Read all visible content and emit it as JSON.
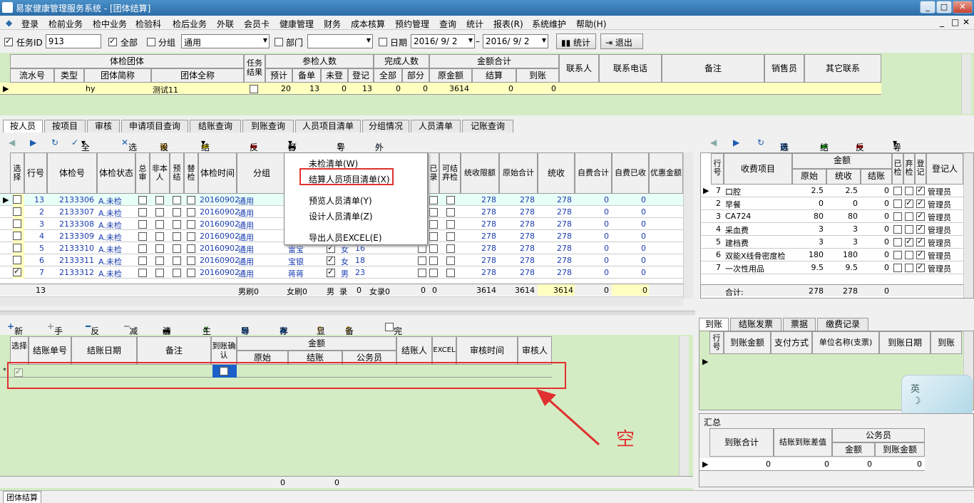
{
  "window": {
    "title": "易家健康管理服务系统 - [团体结算]",
    "min": "_",
    "restore": "□",
    "close": "✕"
  },
  "menu": [
    "登录",
    "检前业务",
    "检中业务",
    "检验科",
    "检后业务",
    "外联",
    "会员卡",
    "健康管理",
    "财务",
    "成本核算",
    "预约管理",
    "查询",
    "统计",
    "报表(R)",
    "系统维护",
    "帮助(H)"
  ],
  "filter": {
    "task_id_label": "任务ID",
    "task_id": "913",
    "all_label": "全部",
    "group_label": "分组",
    "group_value": "通用",
    "dept_label": "部门",
    "dept_value": "",
    "date_label": "日期",
    "date_from": "2016/ 9/ 2",
    "date_sep": "–",
    "date_to": "2016/ 9/ 2",
    "stats": "统计",
    "exit": "退出"
  },
  "top_grid": {
    "group_title": "体检团体",
    "cols1": [
      "流水号",
      "类型",
      "团体简称",
      "团体全称"
    ],
    "task_result": "任务结果",
    "participants": "参检人数",
    "part_cols": [
      "预计",
      "备单",
      "未登",
      "登记"
    ],
    "done": "完成人数",
    "done_cols": [
      "全部",
      "部分"
    ],
    "amount": "金额合计",
    "amount_cols": [
      "原金额",
      "结算",
      "到账"
    ],
    "contact": "联系人",
    "phone": "联系电话",
    "note": "备注",
    "sales": "销售员",
    "other": "其它联系",
    "row": {
      "serial": "",
      "type": "",
      "short": "hy",
      "full": "测试11",
      "expected": "20",
      "prep": "13",
      "unreg": "0",
      "reg": "13",
      "all": "0",
      "part": "0",
      "orig": "3614",
      "settle": "0",
      "arrived": "0"
    }
  },
  "tabs": [
    "按人员",
    "按项目",
    "审核",
    "申请项目查询",
    "结账查询",
    "到账查询",
    "人员项目清单",
    "分组情况",
    "人员清单",
    "记账查询"
  ],
  "mid_toolbar": [
    "全选",
    "选空",
    "设置",
    "结账",
    "反结",
    "打印",
    "导出",
    "外联"
  ],
  "mid_headers": [
    "选择",
    "行号",
    "体检号",
    "体检状态",
    "总审",
    "非本人",
    "预结",
    "替检",
    "体检时间",
    "分组",
    "已录",
    "可结弃检",
    "统收限额",
    "原始合计",
    "统收",
    "自费合计",
    "自费已收",
    "优惠金额"
  ],
  "persons": [
    {
      "no": "13",
      "id": "2133306",
      "status": "A.未检",
      "time": "20160902",
      "group": "通用",
      "name": "",
      "sex": "",
      "age": "",
      "limit": "278",
      "orig": "278",
      "coll": "278",
      "self": "0",
      "paid": "0",
      "sel": false
    },
    {
      "no": "2",
      "id": "2133307",
      "status": "A.未检",
      "time": "20160902",
      "group": "通用",
      "name": "",
      "sex": "",
      "age": "",
      "limit": "278",
      "orig": "278",
      "coll": "278",
      "self": "0",
      "paid": "0",
      "sel": false
    },
    {
      "no": "3",
      "id": "2133308",
      "status": "A.未检",
      "time": "20160902",
      "group": "通用",
      "name": "",
      "sex": "",
      "age": "",
      "limit": "278",
      "orig": "278",
      "coll": "278",
      "self": "0",
      "paid": "0",
      "sel": false
    },
    {
      "no": "4",
      "id": "2133309",
      "status": "A.未检",
      "time": "20160902",
      "group": "通用",
      "name": "",
      "sex": "",
      "age": "",
      "limit": "278",
      "orig": "278",
      "coll": "278",
      "self": "0",
      "paid": "0",
      "sel": false
    },
    {
      "no": "5",
      "id": "2133310",
      "status": "A.未检",
      "time": "20160902",
      "group": "通用",
      "name": "雷宝",
      "sex": "女",
      "age": "16",
      "limit": "278",
      "orig": "278",
      "coll": "278",
      "self": "0",
      "paid": "0",
      "sel": false
    },
    {
      "no": "6",
      "id": "2133311",
      "status": "A.未检",
      "time": "20160902",
      "group": "通用",
      "name": "宝银",
      "sex": "女",
      "age": "18",
      "limit": "278",
      "orig": "278",
      "coll": "278",
      "self": "0",
      "paid": "0",
      "sel": false
    },
    {
      "no": "7",
      "id": "2133312",
      "status": "A.未检",
      "time": "20160902",
      "group": "通用",
      "name": "蒋蒋",
      "sex": "男",
      "age": "23",
      "limit": "278",
      "orig": "278",
      "coll": "278",
      "self": "0",
      "paid": "0",
      "sel": true
    }
  ],
  "mid_footer": {
    "count": "13",
    "male": "男刷0",
    "female": "女刷0",
    "m": "男",
    "rec": "录",
    "zero": "0",
    "frec": "女录0",
    "a": "0",
    "b": "0",
    "limit": "3614",
    "orig": "3614",
    "coll": "3614",
    "self": "0",
    "paid": "0"
  },
  "popup": [
    "未检清单(W)",
    "结算人员项目清单(X)",
    "预览人员清单(Y)",
    "设计人员清单(Z)",
    "导出人员EXCEL(E)"
  ],
  "right_toolbar": [
    "选择",
    "结账",
    "反结",
    "导出"
  ],
  "fee_headers": {
    "row": "行号",
    "item": "收费项目",
    "amount": "金额",
    "orig": "原始",
    "coll": "统收",
    "settle": "结账",
    "checked": "已检",
    "waived": "弃检",
    "reg": "登记",
    "reg_by": "登记人"
  },
  "fees": [
    {
      "no": "7",
      "item": "口腔",
      "orig": "2.5",
      "coll": "2.5",
      "settle": "0",
      "c1": false,
      "c2": false,
      "c3": true,
      "by": "管理员"
    },
    {
      "no": "2",
      "item": "早餐",
      "orig": "0",
      "coll": "0",
      "settle": "0",
      "c1": false,
      "c2": true,
      "c3": true,
      "by": "管理员"
    },
    {
      "no": "3",
      "item": "CA724",
      "orig": "80",
      "coll": "80",
      "settle": "0",
      "c1": false,
      "c2": false,
      "c3": true,
      "by": "管理员"
    },
    {
      "no": "4",
      "item": "采血费",
      "orig": "3",
      "coll": "3",
      "settle": "0",
      "c1": false,
      "c2": false,
      "c3": true,
      "by": "管理员"
    },
    {
      "no": "5",
      "item": "建档费",
      "orig": "3",
      "coll": "3",
      "settle": "0",
      "c1": false,
      "c2": true,
      "c3": true,
      "by": "管理员"
    },
    {
      "no": "6",
      "item": "双能X线骨密度检",
      "orig": "180",
      "coll": "180",
      "settle": "0",
      "c1": false,
      "c2": false,
      "c3": true,
      "by": "管理员"
    },
    {
      "no": "7",
      "item": "一次性用品",
      "orig": "9.5",
      "coll": "9.5",
      "settle": "0",
      "c1": false,
      "c2": false,
      "c3": true,
      "by": "管理员"
    }
  ],
  "fee_total": {
    "label": "合计:",
    "orig": "278",
    "coll": "278",
    "settle": "0"
  },
  "bottom_toolbar": [
    "新结",
    "手工",
    "反结",
    "减免",
    "清单",
    "生成",
    "导出",
    "存入",
    "显",
    "备忘",
    "完成结算"
  ],
  "bill_headers": [
    "选择",
    "结账单号",
    "结账日期",
    "备注",
    "到账确认",
    "金额",
    "原始",
    "结账",
    "公务员",
    "结账人",
    "EXCEL",
    "审核时间",
    "审核人"
  ],
  "bill_footer": {
    "orig": "0",
    "settle": "0"
  },
  "annot": "空",
  "right_tabs": [
    "到账",
    "结账发票",
    "票据",
    "缴费记录"
  ],
  "arr_headers": [
    "行号",
    "到账金额",
    "支付方式",
    "单位名称(支票)",
    "到账日期",
    "到账"
  ],
  "summary": {
    "title": "汇总",
    "cols": [
      "到账合计",
      "结账到账差值",
      "公务员",
      "金额",
      "到账金额"
    ],
    "vals": [
      "0",
      "0",
      "0",
      "0"
    ]
  },
  "ime": "英",
  "status_tab": "团体结算"
}
